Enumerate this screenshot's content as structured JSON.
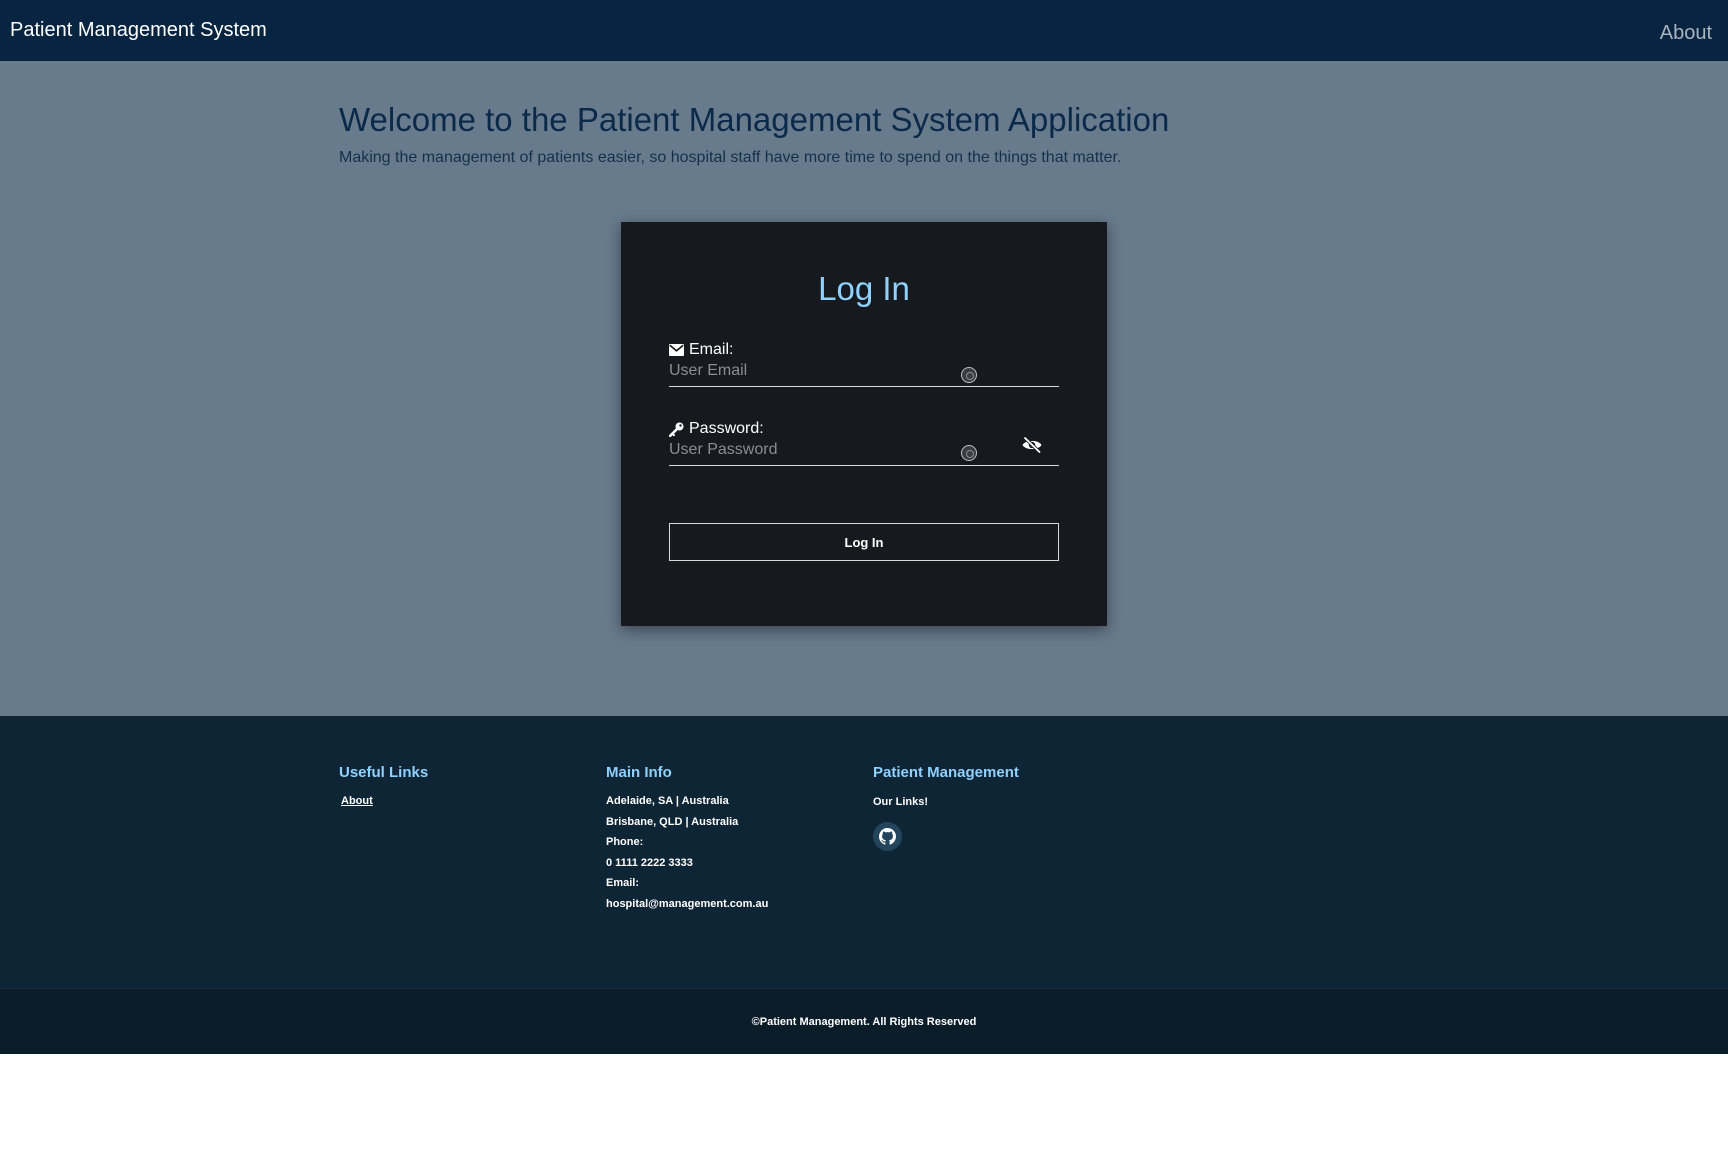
{
  "navbar": {
    "brand": "Patient Management System",
    "about": "About"
  },
  "hero": {
    "title": "Welcome to the Patient Management System Application",
    "subtitle": "Making the management of patients easier, so hospital staff have more time to spend on the things that matter."
  },
  "login": {
    "title": "Log In",
    "email_label": "Email:",
    "email_placeholder": "User Email",
    "password_label": "Password:",
    "password_placeholder": "User Password",
    "submit_label": "Log In"
  },
  "footer": {
    "useful_links": {
      "heading": "Useful Links",
      "items": [
        "About"
      ]
    },
    "main_info": {
      "heading": "Main Info",
      "lines": [
        "Adelaide, SA | Australia",
        "Brisbane, QLD | Australia",
        "Phone:",
        "0 1111 2222 3333",
        "Email:",
        "hospital@management.com.au"
      ]
    },
    "patient_management": {
      "heading": "Patient Management",
      "links_label": "Our Links!"
    },
    "copyright": "©Patient Management. All Rights Reserved"
  },
  "icons": {
    "email": "envelope-icon",
    "password": "key-icon",
    "toggle_password": "eye-slash-icon",
    "github": "github-icon"
  },
  "colors": {
    "navbar": "#072541",
    "main_bg": "#687b8c",
    "card_bg": "#16191d",
    "accent": "#8fd1ff",
    "footer_bg": "#0e2535",
    "copyright_bg": "#0b1d29"
  }
}
